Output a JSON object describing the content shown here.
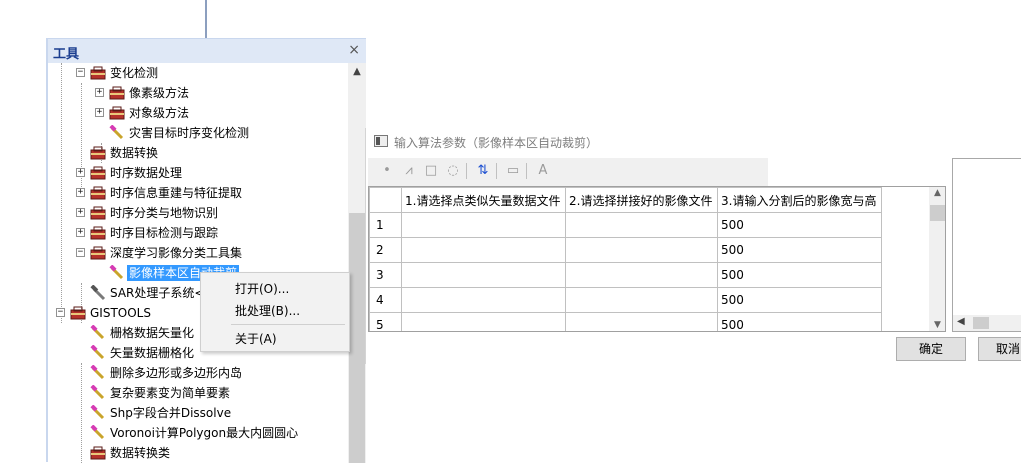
{
  "tools_panel": {
    "title": "工具",
    "close": "×",
    "tree": [
      {
        "label": "变化检测",
        "kind": "toolbox",
        "expander": "−"
      },
      {
        "label": "像素级方法",
        "kind": "toolbox",
        "expander": "+"
      },
      {
        "label": "对象级方法",
        "kind": "toolbox",
        "expander": "+"
      },
      {
        "label": "灾害目标时序变化检测",
        "kind": "tool"
      },
      {
        "label": "数据转换",
        "kind": "toolbox"
      },
      {
        "label": "时序数据处理",
        "kind": "toolbox",
        "expander": "+"
      },
      {
        "label": "时序信息重建与特征提取",
        "kind": "toolbox",
        "expander": "+"
      },
      {
        "label": "时序分类与地物识别",
        "kind": "toolbox",
        "expander": "+"
      },
      {
        "label": "时序目标检测与跟踪",
        "kind": "toolbox",
        "expander": "+"
      },
      {
        "label": "深度学习影像分类工具集",
        "kind": "toolbox",
        "expander": "−"
      },
      {
        "label": "影像样本区自动裁剪",
        "kind": "tool",
        "selected": true
      },
      {
        "label": "SAR处理子系统<",
        "kind": "hammer"
      },
      {
        "label": "GISTOOLS",
        "kind": "toolbox",
        "expander": "−"
      },
      {
        "label": "栅格数据矢量化",
        "kind": "tool"
      },
      {
        "label": "矢量数据栅格化",
        "kind": "tool"
      },
      {
        "label": "删除多边形或多边形内岛",
        "kind": "tool"
      },
      {
        "label": "复杂要素变为简单要素",
        "kind": "tool"
      },
      {
        "label": "Shp字段合并Dissolve",
        "kind": "tool"
      },
      {
        "label": "Voronoi计算Polygon最大内圆圆心",
        "kind": "tool"
      },
      {
        "label": "数据转换类",
        "kind": "toolbox"
      }
    ]
  },
  "context_menu": {
    "open": "打开(O)...",
    "batch": "批处理(B)...",
    "about": "关于(A)"
  },
  "dialog": {
    "title": "输入算法参数（影像样本区自动裁剪）",
    "columns": [
      "1.请选择点类似矢量数据文件",
      "2.请选择拼接好的影像文件",
      "3.请输入分割后的影像宽与高"
    ],
    "rows": [
      {
        "num": "1",
        "c1": "",
        "c2": "",
        "c3": "500"
      },
      {
        "num": "2",
        "c1": "",
        "c2": "",
        "c3": "500"
      },
      {
        "num": "3",
        "c1": "",
        "c2": "",
        "c3": "500"
      },
      {
        "num": "4",
        "c1": "",
        "c2": "",
        "c3": "500"
      },
      {
        "num": "5",
        "c1": "",
        "c2": "",
        "c3": "500"
      }
    ],
    "ok": "确定",
    "cancel": "取消"
  }
}
